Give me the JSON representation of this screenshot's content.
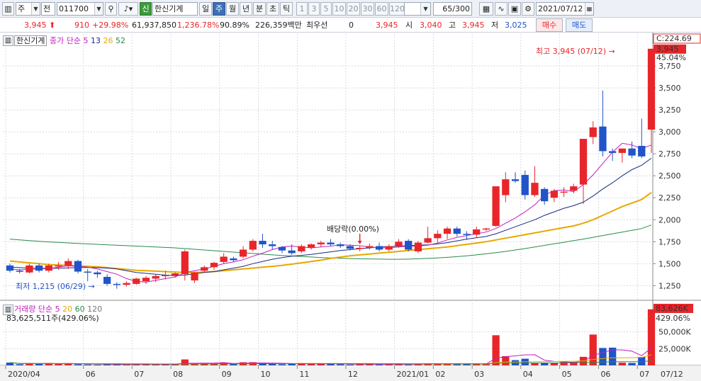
{
  "toolbar": {
    "market": "주",
    "period_mode": "전",
    "code": "011700",
    "badge": "신",
    "name": "한신기계",
    "periods": [
      "일",
      "주",
      "월",
      "년",
      "분",
      "초",
      "틱"
    ],
    "active_period": "주",
    "intervals": [
      "1",
      "3",
      "5",
      "10",
      "20",
      "30",
      "60",
      "120"
    ],
    "count": "65/300",
    "date": "2021/07/12"
  },
  "quote": {
    "price": "3,945",
    "change": "910",
    "change_pct": "+29.98%",
    "volume": "61,937,850",
    "volume_pct": "1,236.78%",
    "ratio": "90.89%",
    "amount": "226,359백만",
    "credit_label": "최우선",
    "credit_value": "0",
    "best_price": "3,945",
    "open_label": "시",
    "open": "3,040",
    "high_label": "고",
    "high": "3,945",
    "low_label": "저",
    "low": "3,025",
    "buy_label": "매수",
    "sell_label": "매도"
  },
  "price_panel": {
    "stock": "한신기계",
    "ma_title": "종가 단순",
    "ma_periods": [
      "5",
      "13",
      "26",
      "52"
    ],
    "ma_colors": [
      "#c020c0",
      "#1a2a80",
      "#e8a800",
      "#2a8a4a"
    ],
    "high_note": "최고 3,945 (07/12)",
    "low_note": "최저 1,215 (06/29)",
    "dividend_note": "배당락(0.00%)",
    "current_badge": "3,945",
    "pct_badge": "45.04%",
    "top_label": "C:224.69",
    "y_ticks": [
      "3,750",
      "3,500",
      "3,250",
      "3,000",
      "2,750",
      "2,500",
      "2,250",
      "2,000",
      "1,750",
      "1,500",
      "1,250"
    ]
  },
  "volume_panel": {
    "title": "거래량",
    "ma_title": "단순",
    "ma_periods": [
      "5",
      "20",
      "60",
      "120"
    ],
    "ma_colors": [
      "#c020c0",
      "#e8a800",
      "#2a8a4a",
      "#777777"
    ],
    "value_text": "83,625,511주(429.06%)",
    "badge": "83,626K",
    "pct": "429.06%",
    "y_ticks": [
      "50,000K",
      "25,000K"
    ]
  },
  "x_axis": [
    "2020/04",
    "06",
    "07",
    "08",
    "09",
    "10",
    "11",
    "12",
    "2021/01",
    "02",
    "03",
    "04",
    "05",
    "06",
    "07",
    "07/12"
  ],
  "chart_data": {
    "type": "candlestick",
    "period": "weekly",
    "ylim": [
      1100,
      4000
    ],
    "volume_ylim": [
      0,
      95000
    ],
    "volume_unit": "K shares",
    "candles": [
      {
        "o": 1480,
        "h": 1500,
        "l": 1400,
        "c": 1420
      },
      {
        "o": 1420,
        "h": 1440,
        "l": 1390,
        "c": 1410
      },
      {
        "o": 1400,
        "h": 1500,
        "l": 1390,
        "c": 1480
      },
      {
        "o": 1480,
        "h": 1500,
        "l": 1400,
        "c": 1420
      },
      {
        "o": 1420,
        "h": 1500,
        "l": 1400,
        "c": 1480
      },
      {
        "o": 1470,
        "h": 1520,
        "l": 1430,
        "c": 1480
      },
      {
        "o": 1480,
        "h": 1560,
        "l": 1440,
        "c": 1530
      },
      {
        "o": 1530,
        "h": 1545,
        "l": 1390,
        "c": 1410
      },
      {
        "o": 1410,
        "h": 1440,
        "l": 1300,
        "c": 1400
      },
      {
        "o": 1400,
        "h": 1420,
        "l": 1340,
        "c": 1380
      },
      {
        "o": 1350,
        "h": 1380,
        "l": 1250,
        "c": 1270
      },
      {
        "o": 1270,
        "h": 1290,
        "l": 1215,
        "c": 1260
      },
      {
        "o": 1260,
        "h": 1300,
        "l": 1240,
        "c": 1280
      },
      {
        "o": 1270,
        "h": 1340,
        "l": 1260,
        "c": 1330
      },
      {
        "o": 1300,
        "h": 1360,
        "l": 1270,
        "c": 1340
      },
      {
        "o": 1330,
        "h": 1380,
        "l": 1290,
        "c": 1360
      },
      {
        "o": 1360,
        "h": 1420,
        "l": 1320,
        "c": 1370
      },
      {
        "o": 1370,
        "h": 1400,
        "l": 1340,
        "c": 1390
      },
      {
        "o": 1380,
        "h": 1660,
        "l": 1310,
        "c": 1640
      },
      {
        "o": 1310,
        "h": 1410,
        "l": 1280,
        "c": 1400
      },
      {
        "o": 1420,
        "h": 1480,
        "l": 1400,
        "c": 1460
      },
      {
        "o": 1460,
        "h": 1520,
        "l": 1430,
        "c": 1510
      },
      {
        "o": 1520,
        "h": 1620,
        "l": 1500,
        "c": 1580
      },
      {
        "o": 1560,
        "h": 1580,
        "l": 1520,
        "c": 1540
      },
      {
        "o": 1580,
        "h": 1700,
        "l": 1560,
        "c": 1660
      },
      {
        "o": 1660,
        "h": 1780,
        "l": 1640,
        "c": 1760
      },
      {
        "o": 1760,
        "h": 1840,
        "l": 1680,
        "c": 1720
      },
      {
        "o": 1720,
        "h": 1760,
        "l": 1660,
        "c": 1700
      },
      {
        "o": 1690,
        "h": 1700,
        "l": 1620,
        "c": 1650
      },
      {
        "o": 1650,
        "h": 1720,
        "l": 1600,
        "c": 1620
      },
      {
        "o": 1640,
        "h": 1720,
        "l": 1620,
        "c": 1700
      },
      {
        "o": 1680,
        "h": 1730,
        "l": 1660,
        "c": 1720
      },
      {
        "o": 1720,
        "h": 1760,
        "l": 1690,
        "c": 1740
      },
      {
        "o": 1740,
        "h": 1780,
        "l": 1700,
        "c": 1720
      },
      {
        "o": 1720,
        "h": 1740,
        "l": 1680,
        "c": 1700
      },
      {
        "o": 1700,
        "h": 1720,
        "l": 1650,
        "c": 1670
      },
      {
        "o": 1670,
        "h": 1700,
        "l": 1640,
        "c": 1680
      },
      {
        "o": 1680,
        "h": 1730,
        "l": 1660,
        "c": 1700
      },
      {
        "o": 1700,
        "h": 1740,
        "l": 1640,
        "c": 1660
      },
      {
        "o": 1660,
        "h": 1720,
        "l": 1640,
        "c": 1700
      },
      {
        "o": 1700,
        "h": 1780,
        "l": 1680,
        "c": 1750
      },
      {
        "o": 1760,
        "h": 1780,
        "l": 1640,
        "c": 1660
      },
      {
        "o": 1640,
        "h": 1760,
        "l": 1620,
        "c": 1740
      },
      {
        "o": 1740,
        "h": 1920,
        "l": 1730,
        "c": 1790
      },
      {
        "o": 1790,
        "h": 1880,
        "l": 1740,
        "c": 1840
      },
      {
        "o": 1840,
        "h": 1920,
        "l": 1780,
        "c": 1900
      },
      {
        "o": 1900,
        "h": 1920,
        "l": 1810,
        "c": 1840
      },
      {
        "o": 1840,
        "h": 1870,
        "l": 1770,
        "c": 1830
      },
      {
        "o": 1830,
        "h": 1920,
        "l": 1800,
        "c": 1890
      },
      {
        "o": 1900,
        "h": 1910,
        "l": 1870,
        "c": 1900
      },
      {
        "o": 1930,
        "h": 2300,
        "l": 1920,
        "c": 2380
      },
      {
        "o": 2280,
        "h": 2540,
        "l": 2200,
        "c": 2460
      },
      {
        "o": 2460,
        "h": 2540,
        "l": 2420,
        "c": 2440
      },
      {
        "o": 2510,
        "h": 2560,
        "l": 2230,
        "c": 2280
      },
      {
        "o": 2280,
        "h": 2610,
        "l": 2260,
        "c": 2420
      },
      {
        "o": 2350,
        "h": 2370,
        "l": 2170,
        "c": 2210
      },
      {
        "o": 2250,
        "h": 2350,
        "l": 2200,
        "c": 2330
      },
      {
        "o": 2310,
        "h": 2370,
        "l": 2260,
        "c": 2320
      },
      {
        "o": 2330,
        "h": 2410,
        "l": 2300,
        "c": 2380
      },
      {
        "o": 2400,
        "h": 2920,
        "l": 2180,
        "c": 2920
      },
      {
        "o": 2940,
        "h": 3120,
        "l": 2860,
        "c": 3050
      },
      {
        "o": 3060,
        "h": 3470,
        "l": 2720,
        "c": 2780
      },
      {
        "o": 2780,
        "h": 2810,
        "l": 2670,
        "c": 2760
      },
      {
        "o": 2760,
        "h": 2800,
        "l": 2650,
        "c": 2810
      },
      {
        "o": 2810,
        "h": 2890,
        "l": 2700,
        "c": 2730
      },
      {
        "o": 2840,
        "h": 3150,
        "l": 2700,
        "c": 2720
      },
      {
        "o": 3025,
        "h": 3945,
        "l": 2760,
        "c": 3945
      }
    ],
    "volume": [
      4200,
      1800,
      2600,
      2200,
      3500,
      2300,
      3000,
      1800,
      1400,
      1000,
      1900,
      1700,
      1200,
      1900,
      2100,
      1800,
      1600,
      1500,
      8900,
      2400,
      3100,
      2200,
      4300,
      2200,
      4700,
      4800,
      2500,
      2500,
      1800,
      2100,
      3400,
      2700,
      2200,
      2400,
      1900,
      1300,
      2300,
      2000,
      1300,
      1600,
      2600,
      1300,
      2300,
      3000,
      2700,
      2700,
      1900,
      2200,
      2500,
      1900,
      45000,
      13800,
      7900,
      10000,
      3100,
      4200,
      4100,
      6000,
      5300,
      12800,
      46000,
      26000,
      26500,
      4100,
      3700,
      12600,
      83626
    ],
    "ma5": [
      1440,
      1430,
      1435,
      1440,
      1445,
      1460,
      1475,
      1470,
      1460,
      1440,
      1410,
      1380,
      1330,
      1300,
      1290,
      1310,
      1330,
      1350,
      1400,
      1420,
      1440,
      1470,
      1500,
      1520,
      1545,
      1585,
      1620,
      1660,
      1690,
      1700,
      1690,
      1680,
      1690,
      1700,
      1715,
      1710,
      1705,
      1690,
      1680,
      1680,
      1690,
      1700,
      1700,
      1710,
      1735,
      1770,
      1800,
      1820,
      1840,
      1860,
      1900,
      1960,
      2020,
      2090,
      2170,
      2280,
      2330,
      2340,
      2320,
      2400,
      2510,
      2640,
      2770,
      2870,
      2850,
      2810,
      2850
    ],
    "ma13": [
      1460,
      1455,
      1450,
      1448,
      1446,
      1448,
      1452,
      1455,
      1456,
      1455,
      1450,
      1440,
      1420,
      1400,
      1390,
      1380,
      1370,
      1365,
      1370,
      1385,
      1400,
      1410,
      1430,
      1450,
      1470,
      1500,
      1525,
      1550,
      1570,
      1585,
      1595,
      1605,
      1620,
      1635,
      1650,
      1660,
      1670,
      1680,
      1688,
      1695,
      1700,
      1705,
      1710,
      1715,
      1725,
      1740,
      1760,
      1780,
      1795,
      1810,
      1840,
      1880,
      1920,
      1960,
      2000,
      2050,
      2090,
      2130,
      2160,
      2200,
      2270,
      2350,
      2420,
      2500,
      2570,
      2620,
      2700
    ],
    "ma26": [
      1530,
      1520,
      1510,
      1500,
      1490,
      1485,
      1480,
      1475,
      1470,
      1465,
      1455,
      1445,
      1435,
      1425,
      1420,
      1415,
      1410,
      1405,
      1400,
      1400,
      1405,
      1410,
      1420,
      1430,
      1440,
      1450,
      1460,
      1470,
      1480,
      1495,
      1510,
      1525,
      1540,
      1560,
      1575,
      1590,
      1600,
      1610,
      1620,
      1630,
      1640,
      1650,
      1660,
      1670,
      1680,
      1690,
      1705,
      1720,
      1735,
      1750,
      1770,
      1790,
      1810,
      1830,
      1850,
      1870,
      1890,
      1910,
      1930,
      1960,
      2000,
      2050,
      2100,
      2150,
      2190,
      2230,
      2310
    ],
    "ma52": [
      1780,
      1770,
      1762,
      1755,
      1748,
      1742,
      1736,
      1730,
      1725,
      1720,
      1715,
      1710,
      1705,
      1700,
      1695,
      1690,
      1685,
      1680,
      1672,
      1664,
      1656,
      1648,
      1640,
      1632,
      1624,
      1616,
      1608,
      1600,
      1594,
      1588,
      1582,
      1576,
      1570,
      1566,
      1562,
      1558,
      1556,
      1554,
      1552,
      1550,
      1550,
      1552,
      1556,
      1560,
      1566,
      1572,
      1580,
      1590,
      1600,
      1612,
      1626,
      1640,
      1656,
      1672,
      1690,
      1708,
      1726,
      1744,
      1762,
      1780,
      1800,
      1820,
      1840,
      1860,
      1880,
      1900,
      1940
    ]
  }
}
